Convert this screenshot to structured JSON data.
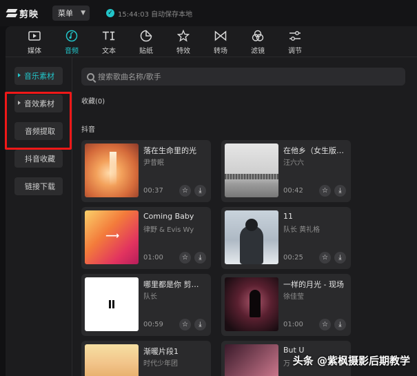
{
  "app": {
    "name": "剪映",
    "menu_label": "菜单",
    "save_status": "15:44:03 自动保存本地"
  },
  "tabs": [
    {
      "label": "媒体",
      "icon": "media-icon",
      "active": false
    },
    {
      "label": "音频",
      "icon": "audio-icon",
      "active": true
    },
    {
      "label": "文本",
      "icon": "text-icon",
      "active": false
    },
    {
      "label": "贴纸",
      "icon": "sticker-icon",
      "active": false
    },
    {
      "label": "特效",
      "icon": "effects-icon",
      "active": false
    },
    {
      "label": "转场",
      "icon": "transition-icon",
      "active": false
    },
    {
      "label": "滤镜",
      "icon": "filter-icon",
      "active": false
    },
    {
      "label": "调节",
      "icon": "adjust-icon",
      "active": false
    }
  ],
  "sidebar": {
    "items": [
      {
        "label": "音乐素材",
        "active": true
      },
      {
        "label": "音效素材",
        "active": false
      },
      {
        "label": "音频提取",
        "active": false
      },
      {
        "label": "抖音收藏",
        "active": false
      },
      {
        "label": "链接下载",
        "active": false
      }
    ]
  },
  "search": {
    "placeholder": "搜索歌曲名称/歌手"
  },
  "favorites": {
    "label": "收藏(0)"
  },
  "section": {
    "label": "抖音"
  },
  "tracks": [
    {
      "title": "落在生命里的光",
      "artist": "尹昔眠",
      "duration": "00:37"
    },
    {
      "title": "在他乡（女生版…",
      "artist": "汪六六",
      "duration": "00:42"
    },
    {
      "title": "Coming Baby",
      "artist": "律野 & Evis Wy",
      "duration": "01:00"
    },
    {
      "title": "11",
      "artist": "队长 黄礼格",
      "duration": "00:25"
    },
    {
      "title": "哪里都是你 剪…",
      "artist": "队长",
      "duration": "00:59"
    },
    {
      "title": "一样的月光 - 现场",
      "artist": "徐佳莹",
      "duration": "01:00"
    },
    {
      "title": "渐暖片段1",
      "artist": "时代少年团",
      "duration": ""
    },
    {
      "title": "But U",
      "artist": "万",
      "duration": ""
    }
  ],
  "watermark": "头条 @紫枫摄影后期教学"
}
